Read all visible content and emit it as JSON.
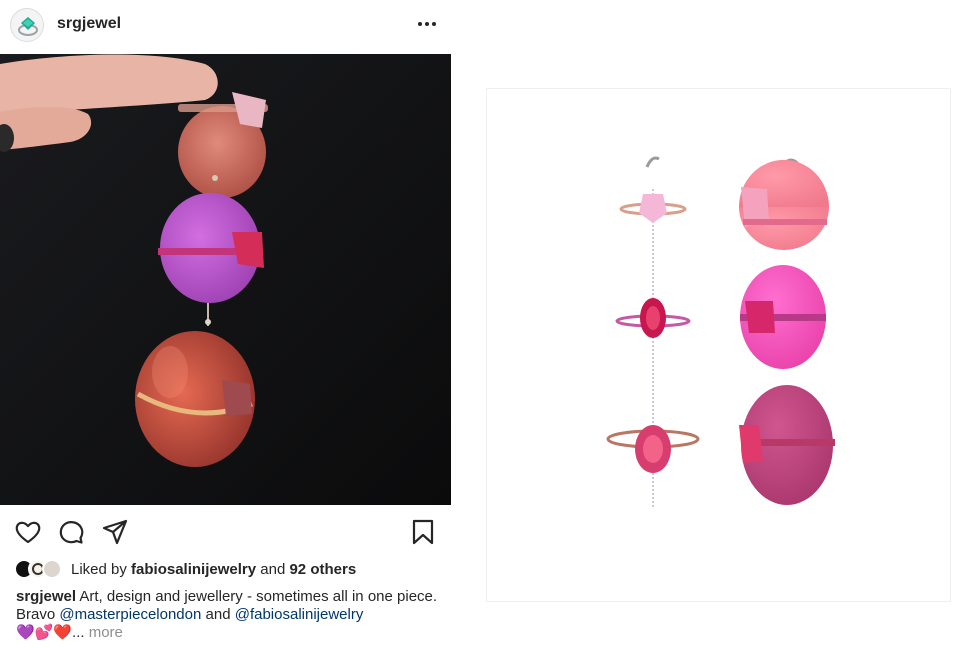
{
  "post": {
    "username": "srgjewel",
    "more_icon": "ellipsis-icon"
  },
  "actions": {
    "like_icon": "heart-icon",
    "comment_icon": "comment-icon",
    "share_icon": "paper-plane-icon",
    "save_icon": "bookmark-icon"
  },
  "likes": {
    "prefix": "Liked by ",
    "user": "fabiosalinijewelry",
    "middle": " and ",
    "others": "92 others"
  },
  "caption": {
    "username": "srgjewel",
    "text1": " Art, design and jewellery - sometimes all in one piece. Bravo ",
    "mention1": "@masterpiecelondon",
    "text2": " and ",
    "mention2": "@fabiosalinijewelry",
    "emojis": "💜💕❤️",
    "ellipsis": "... ",
    "more": "more"
  },
  "colors": {
    "text": "#262626",
    "mention": "#00376b",
    "muted": "#8e8e8e",
    "photo_bg": "#111214"
  }
}
